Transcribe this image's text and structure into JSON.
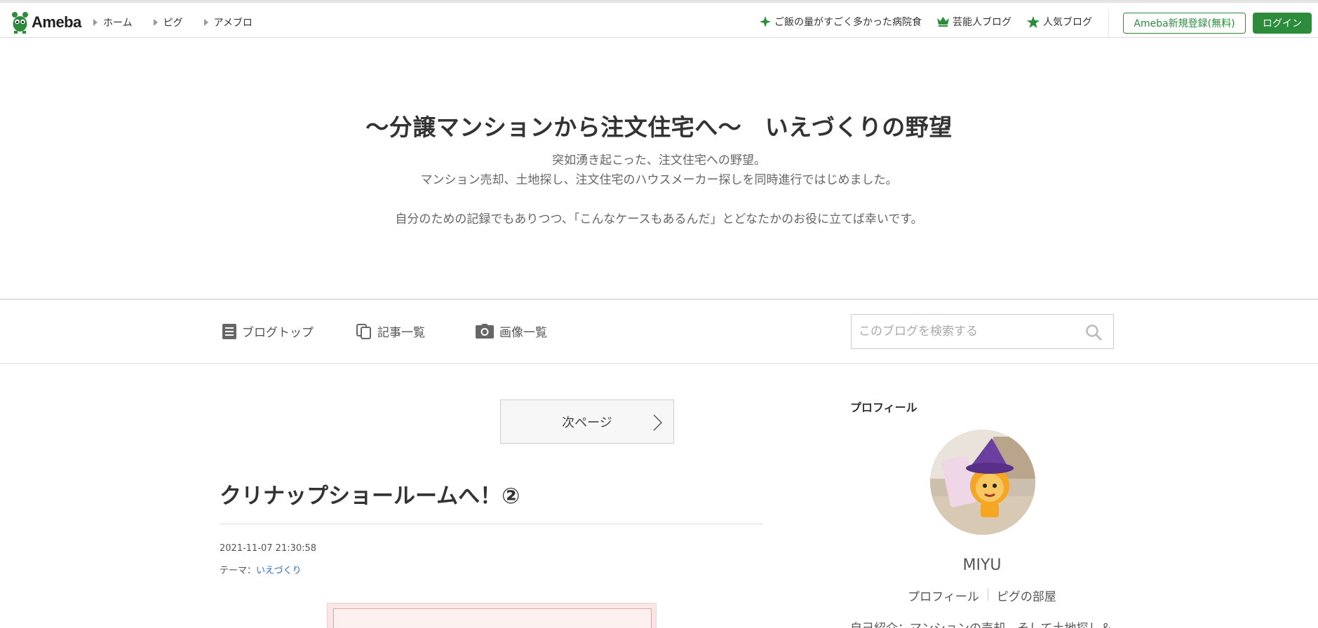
{
  "header": {
    "logo_text": "Ameba",
    "nav": [
      "ホーム",
      "ピグ",
      "アメブロ"
    ],
    "right_links": [
      {
        "label": "ご飯の量がすごく多かった病院食",
        "icon": "sparkle-icon"
      },
      {
        "label": "芸能人ブログ",
        "icon": "crown-icon"
      },
      {
        "label": "人気ブログ",
        "icon": "star-icon"
      }
    ],
    "register_label": "Ameba新規登録(無料)",
    "login_label": "ログイン",
    "accent_color": "#2d8c3c"
  },
  "blog": {
    "title": "〜分譲マンションから注文住宅へ〜　いえづくりの野望",
    "description_lines": [
      "突如湧き起こった、注文住宅への野望。",
      "マンション売却、土地探し、注文住宅のハウスメーカー探しを同時進行ではじめました。",
      "",
      "自分のための記録でもありつつ、「こんなケースもあるんだ」とどなたかのお役に立てば幸いです。"
    ]
  },
  "blog_nav": {
    "items": [
      {
        "label": "ブログトップ",
        "icon": "document-icon"
      },
      {
        "label": "記事一覧",
        "icon": "copy-icon"
      },
      {
        "label": "画像一覧",
        "icon": "camera-icon"
      }
    ],
    "search_placeholder": "このブログを検索する"
  },
  "main": {
    "next_page_label": "次ページ",
    "entry": {
      "title": "クリナップショールームへ！②",
      "date": "2021-11-07 21:30:58",
      "theme_prefix": "テーマ：",
      "theme": "いえづくり"
    }
  },
  "sidebar": {
    "heading": "プロフィール",
    "name": "MIYU",
    "links": [
      "プロフィール",
      "ピグの部屋"
    ],
    "intro": "自己紹介：マンションの売却、そして土地探し＆ハ"
  }
}
